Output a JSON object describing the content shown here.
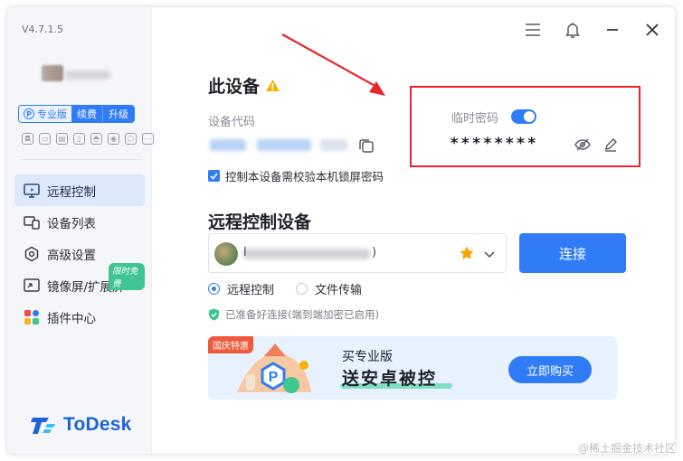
{
  "app": {
    "version": "V4.7.1.5",
    "logo_text": "ToDesk"
  },
  "plan": {
    "pro_label": "专业版",
    "renew_label": "续费",
    "upgrade_label": "升级"
  },
  "sidebar": {
    "items": [
      {
        "label": "远程控制",
        "icon": "monitor-icon",
        "active": true
      },
      {
        "label": "设备列表",
        "icon": "devices-icon",
        "active": false
      },
      {
        "label": "高级设置",
        "icon": "settings-icon",
        "active": false
      },
      {
        "label": "镜像屏/扩展屏",
        "icon": "mirror-icon",
        "active": false,
        "badge": "限时免费"
      },
      {
        "label": "插件中心",
        "icon": "plugins-icon",
        "active": false
      }
    ]
  },
  "device": {
    "title": "此设备",
    "code_label": "设备代码",
    "temp_password_label": "临时密码",
    "temp_password_value": "********",
    "lock_screen_label": "控制本设备需校验本机锁屏密码",
    "lock_screen_checked": true,
    "temp_password_enabled": true
  },
  "remote": {
    "title": "远程控制设备",
    "id_prefix": "l",
    "id_suffix": ")",
    "connect_label": "连接",
    "modes": [
      {
        "label": "远程控制",
        "selected": true
      },
      {
        "label": "文件传输",
        "selected": false
      }
    ],
    "ready_text": "已准备好连接(端到端加密已启用)"
  },
  "banner": {
    "tag": "国庆特惠",
    "line1": "买专业版",
    "line2": "送安卓被控",
    "buy_label": "立即购买"
  },
  "watermark": "@稀土掘金技术社区",
  "colors": {
    "accent": "#2f7cf6",
    "highlight_box": "#e8262c",
    "arrow": "#e8262c",
    "success": "#3fc58f"
  }
}
